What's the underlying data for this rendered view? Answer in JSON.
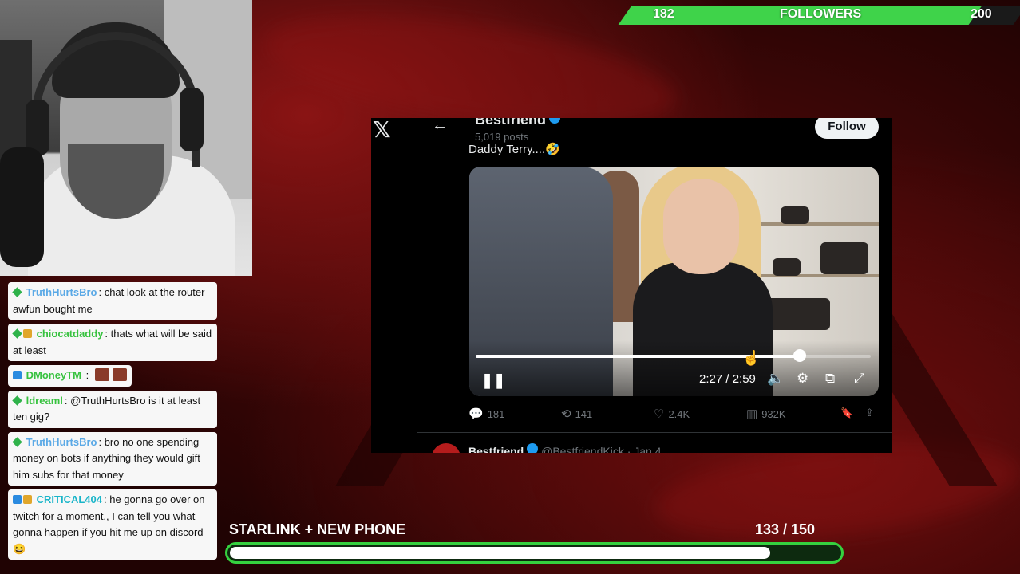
{
  "followers": {
    "current": "182",
    "label": "FOLLOWERS",
    "goal": "200"
  },
  "chat": [
    {
      "user": "TruthHurtsBro",
      "badges": [
        "gem"
      ],
      "text": ": chat look at the router awfun bought me",
      "user_color": "#5aa9e6"
    },
    {
      "user": "chiocatdaddy",
      "badges": [
        "gem",
        "box"
      ],
      "text": ": thats what will be said at least",
      "user_color": "#37c23f"
    },
    {
      "user": "DMoneyTM",
      "badges": [
        "sub"
      ],
      "text": " :",
      "emotes": 2,
      "user_color": "#37c23f"
    },
    {
      "user": "ldreaml",
      "badges": [
        "gem"
      ],
      "text": ": @TruthHurtsBro is it at least ten gig?",
      "user_color": "#37c23f"
    },
    {
      "user": "TruthHurtsBro",
      "badges": [
        "gem"
      ],
      "text": ": bro no one spending money on bots if anything they would gift him subs for that money",
      "user_color": "#5aa9e6"
    },
    {
      "user": "CRITICAL404",
      "badges": [
        "sub",
        "box"
      ],
      "text": ": he gonna go over on twitch for a moment,, I can tell you what gonna happen if you hit me up on discord",
      "emoji": "😆",
      "user_color": "#19b5c9"
    }
  ],
  "tweet": {
    "logo": "𝕏",
    "back": "←",
    "author": "Bestfriend",
    "posts": "5,019 posts",
    "follow_label": "Follow",
    "text": "Daddy Terry....🤣",
    "video": {
      "time": "2:27 / 2:59",
      "progress": 0.82
    },
    "stats": {
      "replies": "181",
      "reposts": "141",
      "likes": "2.4K",
      "views": "932K"
    },
    "reply": {
      "author": "Bestfriend",
      "handle": "@BestfriendKick · Jan 4"
    }
  },
  "goal": {
    "title": "STARLINK + NEW PHONE",
    "count": "133  / 150",
    "current": 133,
    "target": 150
  },
  "colors": {
    "accent_green": "#3fd34a",
    "background_red": "#5a0a0a"
  }
}
